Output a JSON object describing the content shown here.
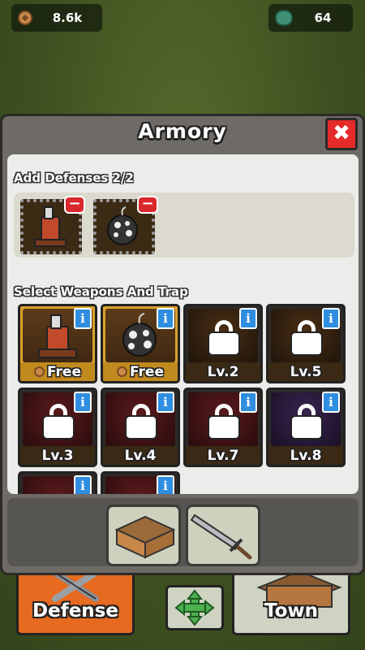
{
  "resources": {
    "coins": {
      "icon": "coin-icon",
      "value": "8.6k"
    },
    "gems": {
      "icon": "gem-icon",
      "value": "64"
    }
  },
  "armory": {
    "title": "Armory",
    "close_icon": "close-x-icon",
    "added_section_label": "Add Defenses 2/2",
    "added_items": [
      {
        "item": "flamethrower-turret",
        "badge": "−"
      },
      {
        "item": "spike-bomb",
        "badge": "−"
      }
    ],
    "select_section_label": "Select Weapons And Trap",
    "weapons": [
      {
        "item": "flamethrower-turret",
        "status": "unlocked",
        "label": "Free",
        "info": "i"
      },
      {
        "item": "spike-bomb",
        "status": "unlocked",
        "label": "Free",
        "info": "i"
      },
      {
        "item": "locked-weapon",
        "status": "locked",
        "label": "Lv.2",
        "info": "i"
      },
      {
        "item": "locked-weapon",
        "status": "locked",
        "label": "Lv.5",
        "info": "i"
      },
      {
        "item": "locked-weapon",
        "status": "locked",
        "label": "Lv.3",
        "info": "i"
      },
      {
        "item": "locked-weapon",
        "status": "locked",
        "label": "Lv.4",
        "info": "i"
      },
      {
        "item": "locked-weapon",
        "status": "locked",
        "label": "Lv.7",
        "info": "i"
      },
      {
        "item": "locked-weapon",
        "status": "locked",
        "label": "Lv.8",
        "info": "i"
      },
      {
        "item": "locked-weapon",
        "status": "locked",
        "label": "",
        "info": "i"
      },
      {
        "item": "locked-weapon",
        "status": "locked",
        "label": "",
        "info": "i"
      }
    ],
    "tray_tabs": [
      {
        "icon": "building-icon",
        "selected": false
      },
      {
        "icon": "sword-icon",
        "selected": false
      }
    ]
  },
  "bottom_nav": {
    "defense_label": "Defense",
    "move_icon": "move-arrows-icon",
    "town_label": "Town"
  },
  "colors": {
    "defense_button": "#e66a20",
    "close_button": "#e52a2a",
    "info_badge": "#2f8ee0",
    "minus_badge": "#d9282c",
    "free_card": "#d9a12a"
  }
}
